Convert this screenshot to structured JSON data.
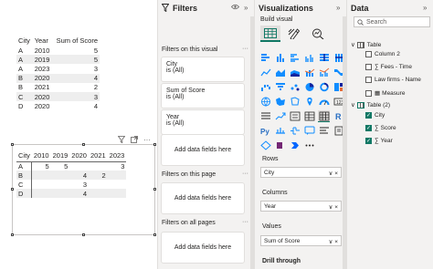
{
  "table": {
    "headers": [
      "City",
      "Year",
      "Sum of Score"
    ],
    "rows": [
      [
        "A",
        "2010",
        "5"
      ],
      [
        "A",
        "2019",
        "5"
      ],
      [
        "A",
        "2023",
        "3"
      ],
      [
        "B",
        "2020",
        "4"
      ],
      [
        "B",
        "2021",
        "2"
      ],
      [
        "C",
        "2020",
        "3"
      ],
      [
        "D",
        "2020",
        "4"
      ]
    ]
  },
  "matrix": {
    "corner": "City",
    "columns": [
      "2010",
      "2019",
      "2020",
      "2021",
      "2023"
    ],
    "rows": [
      {
        "label": "A",
        "values": [
          "5",
          "5",
          "",
          "",
          "3"
        ]
      },
      {
        "label": "B",
        "values": [
          "",
          "",
          "4",
          "2",
          ""
        ]
      },
      {
        "label": "C",
        "values": [
          "",
          "",
          "3",
          "",
          ""
        ]
      },
      {
        "label": "D",
        "values": [
          "",
          "",
          "4",
          "",
          ""
        ]
      }
    ]
  },
  "filters": {
    "title": "Filters",
    "on_visual": "Filters on this visual",
    "cards": [
      {
        "name": "City",
        "state": "is (All)"
      },
      {
        "name": "Sum of Score",
        "state": "is (All)"
      },
      {
        "name": "Year",
        "state": "is (All)"
      }
    ],
    "add_fields": "Add data fields here",
    "on_page": "Filters on this page",
    "on_all_pages": "Filters on all pages",
    "dots": "···"
  },
  "visualizations": {
    "title": "Visualizations",
    "build_visual": "Build visual",
    "rows_label": "Rows",
    "rows_value": "City",
    "columns_label": "Columns",
    "columns_value": "Year",
    "values_label": "Values",
    "values_value": "Sum of Score",
    "drill_through": "Drill through"
  },
  "data": {
    "title": "Data",
    "search_placeholder": "Search",
    "items": [
      {
        "label": "Table",
        "kind": "table",
        "checked": false
      },
      {
        "label": "Column 2",
        "kind": "field",
        "checked": false
      },
      {
        "label": "Fees - Time",
        "kind": "sum",
        "checked": false
      },
      {
        "label": "Law firms - Name",
        "kind": "field",
        "checked": false
      },
      {
        "label": "Measure",
        "kind": "measure",
        "checked": false
      },
      {
        "label": "Table (2)",
        "kind": "table",
        "checked": true
      },
      {
        "label": "City",
        "kind": "field",
        "checked": true
      },
      {
        "label": "Score",
        "kind": "sum",
        "checked": true
      },
      {
        "label": "Year",
        "kind": "sum",
        "checked": true
      }
    ]
  },
  "colors": {
    "accent": "#117865",
    "pane_bg": "#f3f2f1"
  }
}
